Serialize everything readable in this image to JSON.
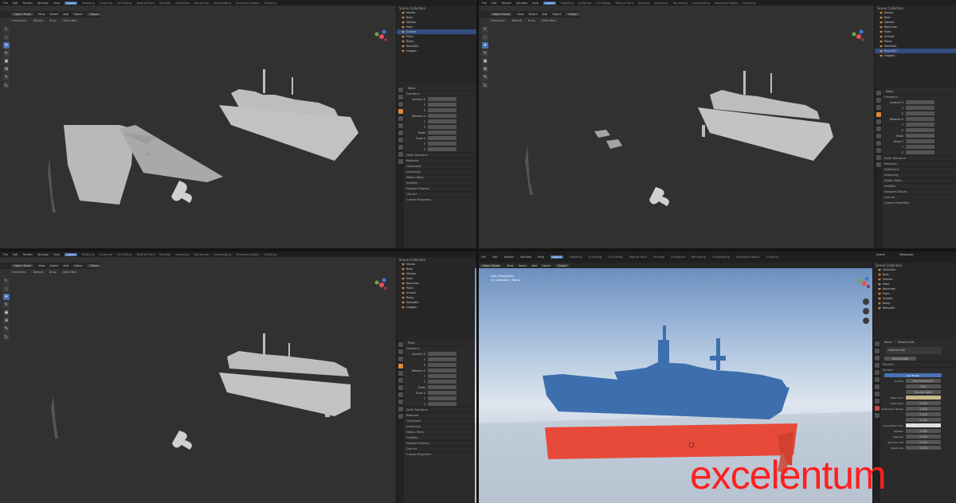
{
  "colors": {
    "accent": "#4772b3",
    "hull_blue": "#3d6fae",
    "hull_red": "#e84a3a",
    "watermark": "#ff1f1f",
    "viewport_bg": "#313131"
  },
  "quad_tl": {
    "menu": [
      "File",
      "Edit",
      "Render",
      "Window",
      "Help",
      "Layout",
      "Modeling",
      "Sculpting",
      "UV Editing",
      "Texture Paint",
      "Shading",
      "Animation",
      "Rendering",
      "Compositing",
      "Geometry Nodes",
      "Scripting"
    ],
    "header": [
      "Object Mode",
      "View",
      "Select",
      "Add",
      "Object",
      "Global"
    ],
    "header2": [
      "Orientation:",
      "Default",
      "Drag:",
      "Select Box"
    ],
    "outliner_title": "Scene Collection",
    "outliner": [
      "Mostra",
      "Baan",
      "Martelo",
      "Mast",
      "Schroef",
      "Pijlen",
      "Romp",
      "Romp001",
      "Vlaggen"
    ],
    "props_title": "Romp",
    "props_rows": [
      "Location X",
      "Y",
      "Z",
      "Rotation X",
      "Y",
      "Z",
      "Mode",
      "Scale X",
      "Y",
      "Z"
    ],
    "props_sections": [
      "Delta Transform",
      "Relations",
      "Collections",
      "Instancing",
      "Motion Paths",
      "Visibility",
      "Viewport Display",
      "Line Art",
      "Custom Properties"
    ]
  },
  "quad_tr": {
    "outliner_title": "Scene Collection",
    "outliner": [
      "Mostra",
      "Baan",
      "Martelo",
      "Rotorvast",
      "Pijlen",
      "Schroef",
      "Romp",
      "Romp001",
      "Romp002",
      "Vlaggen"
    ],
    "props_title": "Romp",
    "props_rows": [
      "Location X",
      "Y",
      "Z",
      "Rotation X",
      "Y",
      "Z",
      "Mode",
      "Scale X",
      "Y",
      "Z"
    ],
    "props_sections": [
      "Delta Transform",
      "Relations",
      "Collections",
      "Instancing",
      "Motion Paths",
      "Visibility",
      "Viewport Display",
      "Line Art",
      "Custom Properties"
    ]
  },
  "quad_bl": {
    "outliner_title": "Scene Collection",
    "outliner": [
      "Mostra",
      "Baan",
      "Martelo",
      "Mast",
      "Rotorvast",
      "Pijlen",
      "Schroef",
      "Romp",
      "Romp001",
      "Vlaggen"
    ],
    "props_title": "Pijlen",
    "props_rows": [
      "Location X",
      "Y",
      "Z",
      "Rotation X",
      "Y",
      "Z",
      "Mode",
      "Scale X",
      "Y",
      "Z"
    ],
    "props_sections": [
      "Delta Transform",
      "Relations",
      "Collections",
      "Instancing",
      "Motion Paths",
      "Visibility",
      "Viewport Display",
      "Line Art",
      "Custom Properties"
    ]
  },
  "quad_br": {
    "menu": [
      "File",
      "Edit",
      "Render",
      "Window",
      "Help",
      "Layout",
      "Modeling",
      "Sculpting",
      "UV Editing",
      "Texture Paint",
      "Shading",
      "Animation",
      "Rendering",
      "Compositing",
      "Geometry Nodes",
      "Scripting"
    ],
    "header": [
      "Object Mode",
      "View",
      "Select",
      "Add",
      "Object",
      "Global"
    ],
    "header2": [
      "Orientation:",
      "Default",
      "Drag:",
      "Select Box"
    ],
    "viewport_info": [
      "User Perspective",
      "(1) Collection | Romp"
    ],
    "scene_label": "Scene",
    "viewlayer_label": "ViewLayer",
    "outliner_title": "Scene Collection",
    "outliner": [
      "Collection",
      "Baan",
      "Martelo",
      "Mast",
      "Rotorvast",
      "Pijlen",
      "Schroef",
      "Romp",
      "Romp001"
    ],
    "material_path": [
      "Romp",
      "Material.006"
    ],
    "material_name": "Material.006",
    "props_sections": [
      "Preview",
      "Surface"
    ],
    "surface_button": "Use Nodes",
    "mat_rows": [
      {
        "label": "Surface",
        "value": "Principled BSDF"
      },
      {
        "label": "",
        "value": "GGX"
      },
      {
        "label": "",
        "value": "Random Walk"
      },
      {
        "label": "Base Color",
        "value": ""
      },
      {
        "label": "Subsurface",
        "value": "0.000"
      },
      {
        "label": "Subsurface Radius",
        "value": "1.000"
      },
      {
        "label": "",
        "value": "0.200"
      },
      {
        "label": "",
        "value": "0.100"
      },
      {
        "label": "Subsurface Color",
        "value": ""
      },
      {
        "label": "Metallic",
        "value": "0.000"
      },
      {
        "label": "Specular",
        "value": "0.500"
      },
      {
        "label": "Specular Tint",
        "value": "0.000"
      },
      {
        "label": "Roughness",
        "value": "0.500"
      }
    ]
  },
  "watermark": "excelentum"
}
